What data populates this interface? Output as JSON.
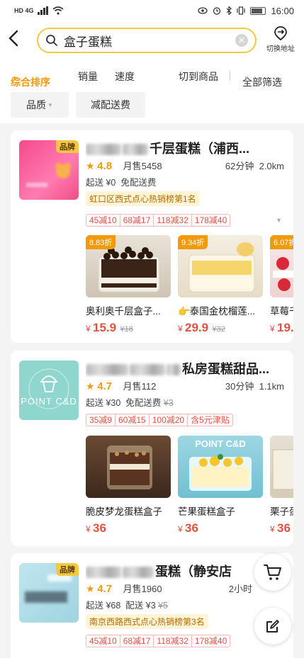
{
  "status_bar": {
    "left_text": "HD 4G",
    "time": "16:00"
  },
  "header": {
    "search_query": "盒子蛋糕",
    "switch_address_label": "切换地址"
  },
  "sort_bar": {
    "comprehensive": "综合排序",
    "sales": "销量",
    "speed": "速度",
    "to_products": "切到商品",
    "all_filters": "全部筛选"
  },
  "filters": [
    "品质",
    "减配送费"
  ],
  "shops": [
    {
      "brand_badge": "品牌",
      "name_visible": "千层蛋糕（浦西...",
      "rating": "4.8",
      "monthly_sales": "月售5458",
      "delivery_time": "62分钟",
      "distance": "2.0km",
      "min_order": "起送 ¥0",
      "delivery_fee": "免配送费",
      "rank_tag": "虹口区西式点心热销榜第1名",
      "promos": [
        "45减10",
        "68减17",
        "118减32",
        "178减40"
      ],
      "items": [
        {
          "discount": "8.83折",
          "name": "奥利奥千层盒子...",
          "price": "15.9",
          "original": "¥18"
        },
        {
          "discount": "9.34折",
          "name": "👉泰国金枕榴莲...",
          "price": "29.9",
          "original": "¥32"
        },
        {
          "discount": "6.07折",
          "name": "草莓千",
          "price": "19.",
          "original": ""
        }
      ]
    },
    {
      "name_visible": "私房蛋糕甜品...",
      "logo_text": "POINT C&D",
      "rating": "4.7",
      "monthly_sales": "月售112",
      "delivery_time": "30分钟",
      "distance": "1.1km",
      "min_order": "起送 ¥30",
      "delivery_fee": "免配送费",
      "delivery_fee_original": "¥3",
      "promos": [
        "35减9",
        "60减15",
        "100减20",
        "含5元津贴"
      ],
      "items": [
        {
          "name": "脆皮梦龙蛋糕盒子",
          "price": "36"
        },
        {
          "name": "芒果蛋糕盒子",
          "price": "36",
          "img_text": "POINT C&D"
        },
        {
          "name": "栗子蛋",
          "price": "36"
        }
      ]
    },
    {
      "brand_badge": "品牌",
      "name_visible": "蛋糕（静安店",
      "rating": "4.7",
      "monthly_sales": "月售1960",
      "delivery_time": "2小时",
      "min_order": "起送 ¥68",
      "delivery_fee": "配送 ¥3",
      "delivery_fee_original": "¥5",
      "rank_tag": "南京西路西式点心热销榜第3名",
      "promos": [
        "45减10",
        "68减17",
        "118减32",
        "178减40"
      ]
    }
  ],
  "colors": {
    "accent": "#f29a0d",
    "price": "#e2513f",
    "search_border": "#f5c842"
  }
}
